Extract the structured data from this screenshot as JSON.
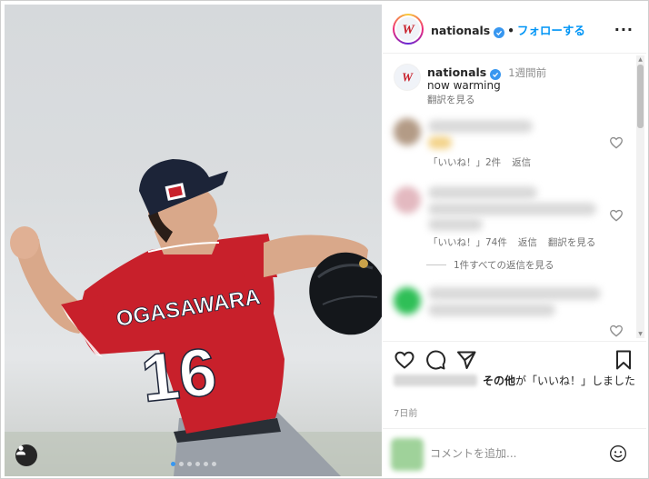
{
  "header": {
    "username": "nationals",
    "separator": "•",
    "follow_label": "フォローする",
    "more_label": "···"
  },
  "caption": {
    "username": "nationals",
    "time": "1週間前",
    "text": "now warming",
    "translate": "翻訳を見る"
  },
  "comments": [
    {
      "likes": "「いいね！」2件",
      "reply": "返信",
      "avatar_color": "#b39b86"
    },
    {
      "likes": "「いいね！」74件",
      "reply": "返信",
      "translate": "翻訳を見る",
      "view_replies": "1件すべての返信を見る",
      "avatar_color": "#e3b9c0"
    },
    {
      "avatar_color": "#2fbf57"
    }
  ],
  "footer": {
    "likes_suffix_bold": "その他",
    "likes_suffix": "が「いいね！」しました",
    "date": "7日前",
    "comment_placeholder": "コメントを追加..."
  },
  "photo": {
    "jersey_name": "OGASAWARA",
    "jersey_number": "16",
    "jersey_color": "#c8202b",
    "cap_color": "#1c2438",
    "carousel_count": 6,
    "carousel_active": 1
  },
  "colors": {
    "accent": "#0095f6",
    "verified": "#3897f0",
    "text": "#262626",
    "muted": "#737373"
  }
}
